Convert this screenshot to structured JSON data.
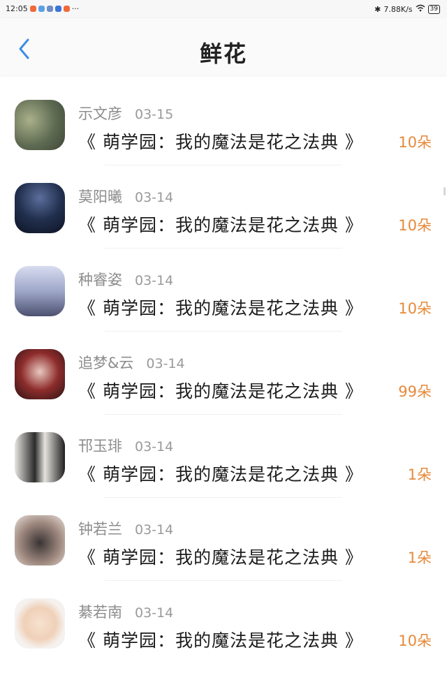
{
  "status": {
    "time": "12:05",
    "network_speed": "7.88K/s",
    "battery": "39",
    "more": "···"
  },
  "header": {
    "title": "鲜花"
  },
  "items": [
    {
      "name": "示文彦",
      "date": "03-15",
      "book": "《 萌学园：我的魔法是花之法典 》",
      "flowers": "10朵"
    },
    {
      "name": "莫阳曦",
      "date": "03-14",
      "book": "《 萌学园：我的魔法是花之法典 》",
      "flowers": "10朵"
    },
    {
      "name": "种睿姿",
      "date": "03-14",
      "book": "《 萌学园：我的魔法是花之法典 》",
      "flowers": "10朵"
    },
    {
      "name": "追梦&云",
      "date": "03-14",
      "book": "《 萌学园：我的魔法是花之法典 》",
      "flowers": "99朵"
    },
    {
      "name": "邗玉琲",
      "date": "03-14",
      "book": "《 萌学园：我的魔法是花之法典 》",
      "flowers": "1朵"
    },
    {
      "name": "钟若兰",
      "date": "03-14",
      "book": "《 萌学园：我的魔法是花之法典 》",
      "flowers": "1朵"
    },
    {
      "name": "綦若南",
      "date": "03-14",
      "book": "《 萌学园：我的魔法是花之法典 》",
      "flowers": "10朵"
    }
  ],
  "colors": {
    "accent": "#3a8ee6",
    "flower_count": "#e58a3a"
  }
}
